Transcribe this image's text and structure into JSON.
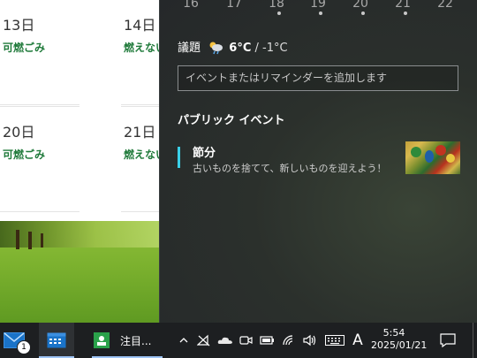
{
  "calendar": {
    "cells": [
      {
        "date": "13日",
        "event": "可燃ごみ"
      },
      {
        "date": "14日",
        "event": "燃えない"
      },
      {
        "date": "20日",
        "event": "可燃ごみ"
      },
      {
        "date": "21日",
        "event": "燃えない"
      }
    ]
  },
  "flyout": {
    "week_numbers": [
      "16",
      "17",
      "18",
      "19",
      "20",
      "21",
      "22"
    ],
    "today": {
      "label": "議題",
      "weather_icon": "cloud-rain-sun-icon",
      "temp_high": "6°C",
      "temp_sep": " / ",
      "temp_low": "-1°C"
    },
    "event_input": {
      "placeholder": "イベントまたはリマインダーを追加します"
    },
    "public_events_title": "パブリック イベント",
    "public_event": {
      "title": "節分",
      "subtitle": "古いものを捨てて、新しいものを迎えよう！",
      "accent_color": "#3ad0e8"
    }
  },
  "taskbar": {
    "mail_badge": "1",
    "app_label": "注目...",
    "ime_label": "A",
    "time": "5:54",
    "date": "2025/01/21",
    "icons": [
      "mail-icon",
      "calendar-icon",
      "app-icon",
      "chevron-up-icon",
      "no-network-icon",
      "onedrive-icon",
      "meet-now-icon",
      "battery-icon",
      "wifi-icon",
      "volume-icon",
      "keyboard-icon",
      "notification-icon"
    ]
  },
  "colors": {
    "flyout_bg": "#25282a",
    "taskbar_bg": "#1d1f21",
    "event_green": "#1f7a3a",
    "accent_blue": "#9ec4f5"
  }
}
